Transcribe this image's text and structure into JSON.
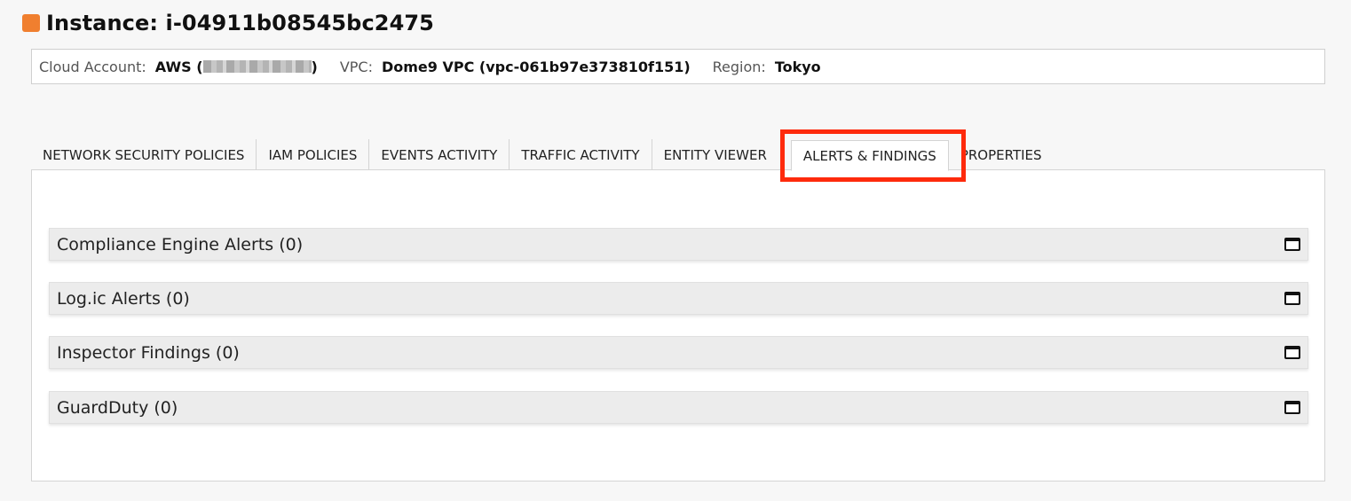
{
  "header": {
    "title": "Instance: i-04911b08545bc2475",
    "icon": "orange-square-icon",
    "icon_color": "#f07f2f"
  },
  "info_bar": {
    "cloud_account_label": "Cloud Account:",
    "cloud_account_prefix": "AWS (",
    "cloud_account_suffix": ")",
    "vpc_label": "VPC:",
    "vpc_value": "Dome9 VPC (vpc-061b97e373810f151)",
    "region_label": "Region:",
    "region_value": "Tokyo"
  },
  "tabs": [
    {
      "label": "NETWORK SECURITY POLICIES",
      "active": false
    },
    {
      "label": "IAM POLICIES",
      "active": false
    },
    {
      "label": "EVENTS ACTIVITY",
      "active": false
    },
    {
      "label": "TRAFFIC ACTIVITY",
      "active": false
    },
    {
      "label": "ENTITY VIEWER",
      "active": false
    },
    {
      "label": "ALERTS & FINDINGS",
      "active": true
    },
    {
      "label": "PROPERTIES",
      "active": false
    }
  ],
  "highlight_color": "#fe2a0c",
  "sections": [
    {
      "title": "Compliance Engine Alerts (0)",
      "icon": "window-icon"
    },
    {
      "title": "Log.ic Alerts (0)",
      "icon": "window-icon"
    },
    {
      "title": "Inspector Findings (0)",
      "icon": "window-icon"
    },
    {
      "title": "GuardDuty (0)",
      "icon": "window-icon"
    }
  ]
}
